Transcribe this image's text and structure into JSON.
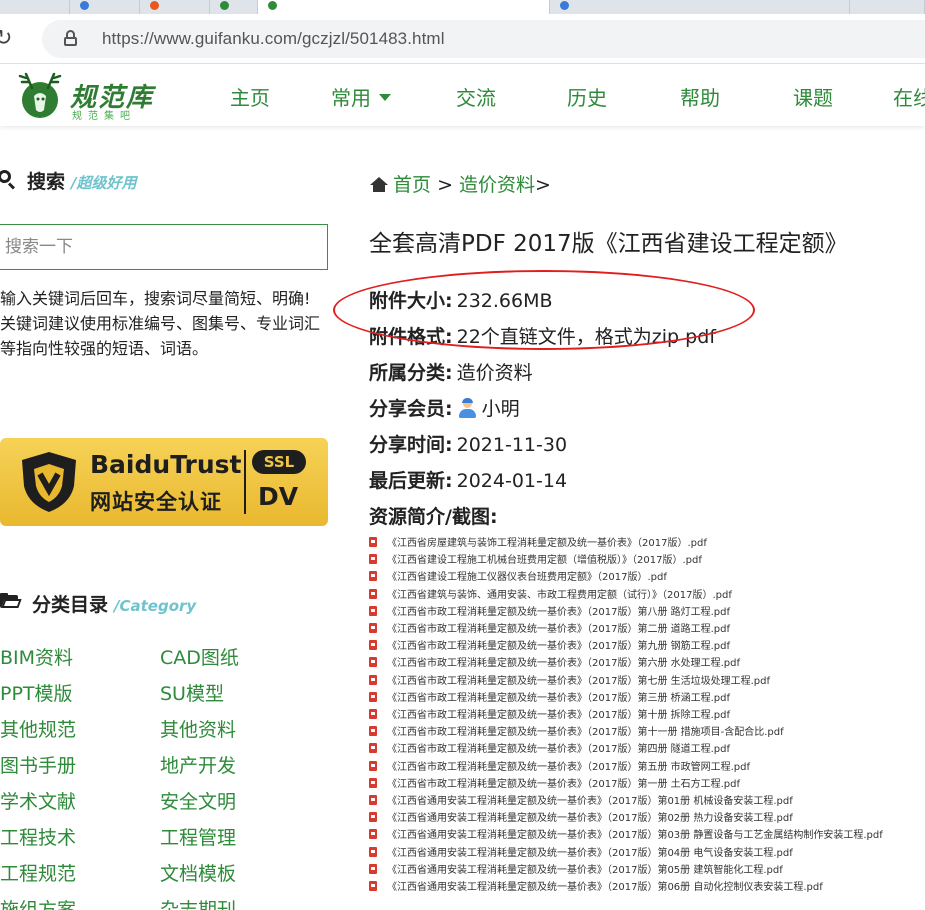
{
  "browser": {
    "url": "https://www.guifanku.com/gczjzl/501483.html"
  },
  "site": {
    "logo_name": "规范库",
    "logo_tagline": "规范集吧",
    "nav": [
      "主页",
      "常用",
      "交流",
      "历史",
      "帮助",
      "课题",
      "在线"
    ]
  },
  "sidebar": {
    "search_title": "搜索",
    "search_subtitle": "/超级好用",
    "search_placeholder": "搜索一下",
    "hint_1": "输入关键词后回车，搜索词尽量简短、明确!",
    "hint_2": "关键词建议使用标准编号、图集号、专业词汇等指向性较强的短语、词语。",
    "trust_badge": {
      "brand": "BaiduTrust",
      "certification": "网站安全认证",
      "ssl": "SSL",
      "level": "DV"
    },
    "category_title": "分类目录",
    "category_subtitle": "/Category",
    "categories": [
      [
        "BIM资料",
        "CAD图纸"
      ],
      [
        "PPT模版",
        "SU模型"
      ],
      [
        "其他规范",
        "其他资料"
      ],
      [
        "图书手册",
        "地产开发"
      ],
      [
        "学术文献",
        "安全文明"
      ],
      [
        "工程技术",
        "工程管理"
      ],
      [
        "工程规范",
        "文档模板"
      ],
      [
        "施组方案",
        "杂志期刊"
      ]
    ]
  },
  "main": {
    "breadcrumb": {
      "home": "首页",
      "sep": ">",
      "section": "造价资料",
      "trail": ">"
    },
    "title": "全套高清PDF 2017版《江西省建设工程定额》",
    "meta": {
      "size_label": "附件大小:",
      "size_value": "232.66MB",
      "format_label": "附件格式:",
      "format_value": "22个直链文件，格式为zip pdf",
      "category_label": "所属分类:",
      "category_value": "造价资料",
      "member_label": "分享会员:",
      "member_value": "小明",
      "share_time_label": "分享时间:",
      "share_time_value": "2021-11-30",
      "updated_label": "最后更新:",
      "updated_value": "2024-01-14",
      "intro_label": "资源简介/截图:"
    },
    "files": [
      "《江西省房屋建筑与装饰工程消耗量定额及统一基价表》（2017版）.pdf",
      "《江西省建设工程施工机械台班费用定额（增值税版）》（2017版）.pdf",
      "《江西省建设工程施工仪器仪表台班费用定额》（2017版）.pdf",
      "《江西省建筑与装饰、通用安装、市政工程费用定额（试行）》（2017版）.pdf",
      "《江西省市政工程消耗量定额及统一基价表》（2017版）第八册 路灯工程.pdf",
      "《江西省市政工程消耗量定额及统一基价表》（2017版）第二册 道路工程.pdf",
      "《江西省市政工程消耗量定额及统一基价表》（2017版）第九册 钢筋工程.pdf",
      "《江西省市政工程消耗量定额及统一基价表》（2017版）第六册 水处理工程.pdf",
      "《江西省市政工程消耗量定额及统一基价表》（2017版）第七册 生活垃圾处理工程.pdf",
      "《江西省市政工程消耗量定额及统一基价表》（2017版）第三册 桥涵工程.pdf",
      "《江西省市政工程消耗量定额及统一基价表》（2017版）第十册 拆除工程.pdf",
      "《江西省市政工程消耗量定额及统一基价表》（2017版）第十一册 措施项目-含配合比.pdf",
      "《江西省市政工程消耗量定额及统一基价表》（2017版）第四册 隧道工程.pdf",
      "《江西省市政工程消耗量定额及统一基价表》（2017版）第五册 市政管网工程.pdf",
      "《江西省市政工程消耗量定额及统一基价表》（2017版）第一册 土石方工程.pdf",
      "《江西省通用安装工程消耗量定额及统一基价表》（2017版）第01册 机械设备安装工程.pdf",
      "《江西省通用安装工程消耗量定额及统一基价表》（2017版）第02册 热力设备安装工程.pdf",
      "《江西省通用安装工程消耗量定额及统一基价表》（2017版）第03册 静置设备与工艺金属结构制作安装工程.pdf",
      "《江西省通用安装工程消耗量定额及统一基价表》（2017版）第04册 电气设备安装工程.pdf",
      "《江西省通用安装工程消耗量定额及统一基价表》（2017版）第05册 建筑智能化工程.pdf",
      "《江西省通用安装工程消耗量定额及统一基价表》（2017版）第06册 自动化控制仪表安装工程.pdf"
    ]
  },
  "colors": {
    "brand_green": "#2e8b3a",
    "accent_teal": "#6fc3cc",
    "annotation_red": "#e01e1e",
    "badge_gold": "#f1c646"
  }
}
